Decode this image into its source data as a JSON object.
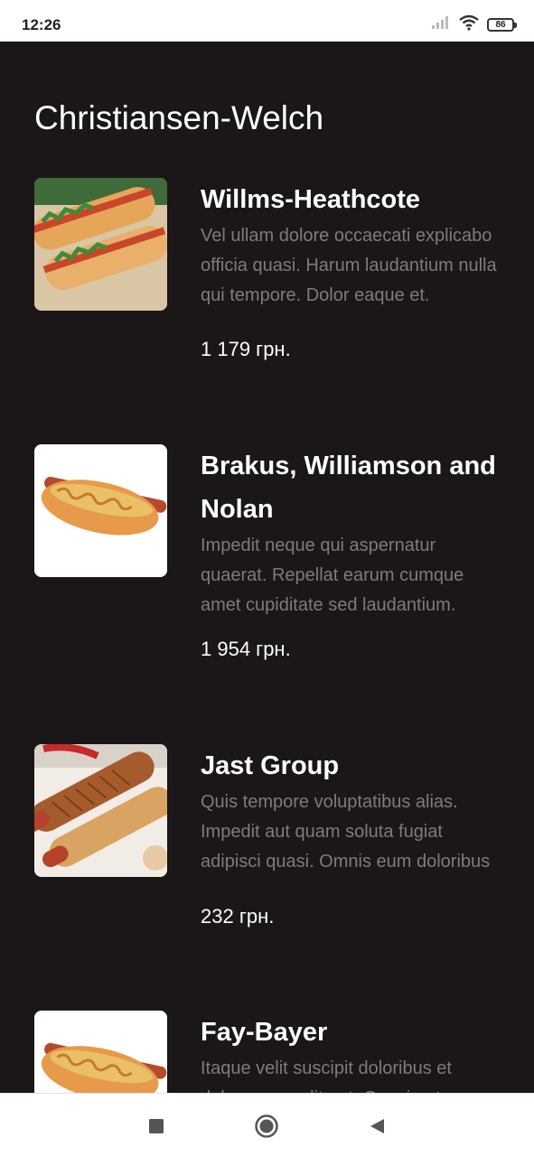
{
  "status": {
    "time": "12:26",
    "battery": "86",
    "icons": [
      "signal-icon",
      "wifi-icon",
      "battery-icon"
    ]
  },
  "page": {
    "title": "Christiansen-Welch"
  },
  "products": [
    {
      "name": "Willms-Heathcote",
      "description": "Vel ullam dolore occaecati explicabo officia quasi. Harum laudantium nulla qui tempore. Dolor eaque et.",
      "price": "1 179 грн."
    },
    {
      "name": "Brakus, Williamson and Nolan",
      "description": "Impedit neque qui aspernatur quaerat. Repellat earum cumque amet cupiditate sed laudantium.",
      "price": "1 954 грн."
    },
    {
      "name": "Jast Group",
      "description": "Quis tempore voluptatibus alias. Impedit aut quam soluta fugiat adipisci quasi. Omnis eum doloribus et ut doloremque.",
      "price": "232 грн."
    },
    {
      "name": "Fay-Bayer",
      "description": "Itaque velit suscipit doloribus et dolores expedita et. Quasi aut.",
      "price": ""
    }
  ],
  "nav": {
    "icons": [
      "recents-icon",
      "home-icon",
      "back-icon"
    ]
  },
  "colors": {
    "background": "#1b1718",
    "text": "#ffffff",
    "muted": "#7d7a7f"
  }
}
